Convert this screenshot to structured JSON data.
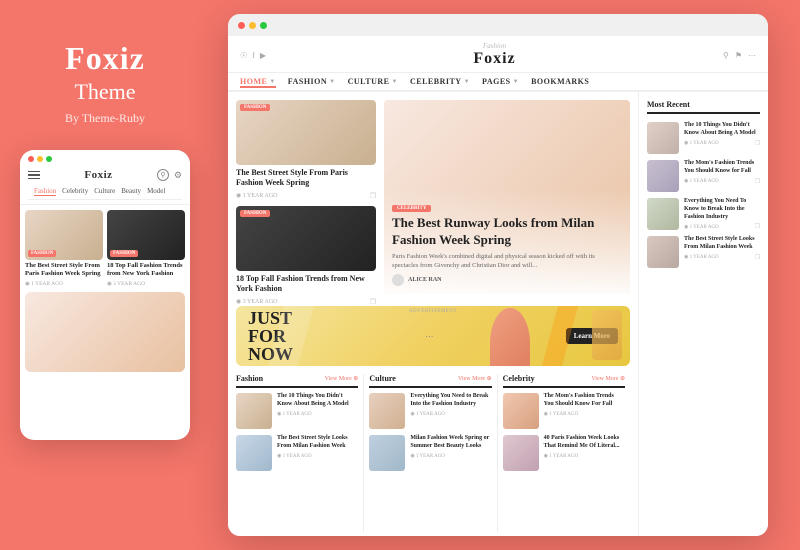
{
  "left_panel": {
    "brand": "Foxiz",
    "subtitle": "Theme",
    "author": "By Theme-Ruby"
  },
  "mobile": {
    "logo": "Foxiz",
    "tabs": [
      "Fashion",
      "Celebrity",
      "Culture",
      "Beauty",
      "Model"
    ],
    "card1": {
      "badge": "FASHION",
      "title": "The Best Street Style From Paris Fashion Week Spring",
      "meta": "1 YEAR AGO"
    },
    "card2": {
      "badge": "FASHION",
      "title": "18 Top Fall Fashion Trends from New York Fashion",
      "meta": "3 YEAR AGO"
    }
  },
  "desktop": {
    "logo_small": "Fashion",
    "logo": "Foxiz",
    "nav": [
      "HOME",
      "FASHION",
      "CULTURE",
      "CELEBRITY",
      "PAGES",
      "BOOKMARKS"
    ],
    "stacked": [
      {
        "badge": "FASHION",
        "title": "The Best Street Style From Paris Fashion Week Spring",
        "meta": "1 YEAR AGO"
      },
      {
        "badge": "FASHION",
        "title": "18 Top Fall Fashion Trends from New York Fashion",
        "meta": "3 YEAR AGO"
      }
    ],
    "hero": {
      "badge": "CELEBRITY",
      "title": "The Best Runway Looks from Milan Fashion Week Spring",
      "desc": "Paris Fashion Week's combined digital and physical season kicked off with its spectacles from Givenchy and Christian Dior and will...",
      "author": "ALICE RAN"
    },
    "sidebar_title": "Most Recent",
    "recent_items": [
      {
        "title": "The 10 Things You Didn't Know About Being A Model",
        "meta": "1 YEAR AGO"
      },
      {
        "title": "The Mom's Fashion Trends You Should Know for Fall",
        "meta": "1 YEAR AGO"
      },
      {
        "title": "Everything You Need To Know to Break Into the Fashion Industry",
        "meta": "1 YEAR AGO"
      },
      {
        "title": "The Best Street Style Looks From Milan Fashion Week",
        "meta": "1 YEAR AGO"
      }
    ],
    "ad": {
      "label": "ADVERTISEMENT",
      "text_line1": "JUST",
      "text_line2": "FOR",
      "text_line3": "NOW",
      "btn": "Learn More"
    },
    "categories": [
      {
        "name": "Fashion",
        "more": "View More ⊕",
        "items": [
          {
            "title": "The 10 Things You Didn't Know About Being A Model",
            "meta": "1 YEAR AGO"
          },
          {
            "title": "The Best Street Style Looks From Milan Fashion Week",
            "meta": "1 YEAR AGO"
          }
        ]
      },
      {
        "name": "Culture",
        "more": "View More ⊕",
        "items": [
          {
            "title": "Everything You Need to Break Into the Fashion Industry",
            "meta": "1 YEAR AGO"
          },
          {
            "title": "Milan Fashion Week Spring or Summer Best Beauty Looks",
            "meta": "1 YEAR AGO"
          }
        ]
      },
      {
        "name": "Celebrity",
        "more": "View More ⊕",
        "items": [
          {
            "title": "The Mom's Fashion Trends You Should Know For Fall",
            "meta": "1 YEAR AGO"
          },
          {
            "title": "40 Paris Fashion Week Looks That Remind Me Of Literal...",
            "meta": "1 YEAR AGO"
          }
        ]
      }
    ]
  }
}
